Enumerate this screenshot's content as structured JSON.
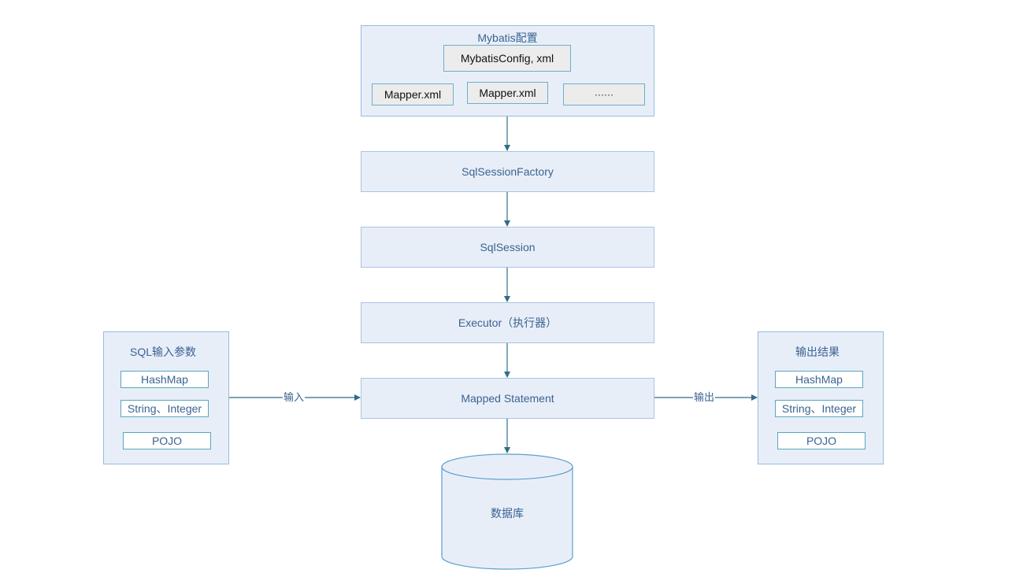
{
  "config_group": {
    "title": "Mybatis配置",
    "main_file": "MybatisConfig, xml",
    "mapper_files": [
      "Mapper.xml",
      "Mapper.xml",
      "······"
    ]
  },
  "flow": {
    "session_factory": "SqlSessionFactory",
    "session": "SqlSession",
    "executor": "Executor（执行器）",
    "mapped_statement": "Mapped Statement"
  },
  "input_group": {
    "title": "SQL输入参数",
    "items": [
      "HashMap",
      "String、Integer",
      "POJO"
    ]
  },
  "output_group": {
    "title": "输出结果",
    "items": [
      "HashMap",
      "String、Integer",
      "POJO"
    ]
  },
  "edges": {
    "input_label": "输入",
    "output_label": "输出"
  },
  "database": {
    "label": "数据库"
  },
  "colors": {
    "panel_fill": "#e8eef8",
    "panel_border": "#93bde0",
    "text": "#3a6391",
    "arrow": "#2f6e86"
  }
}
